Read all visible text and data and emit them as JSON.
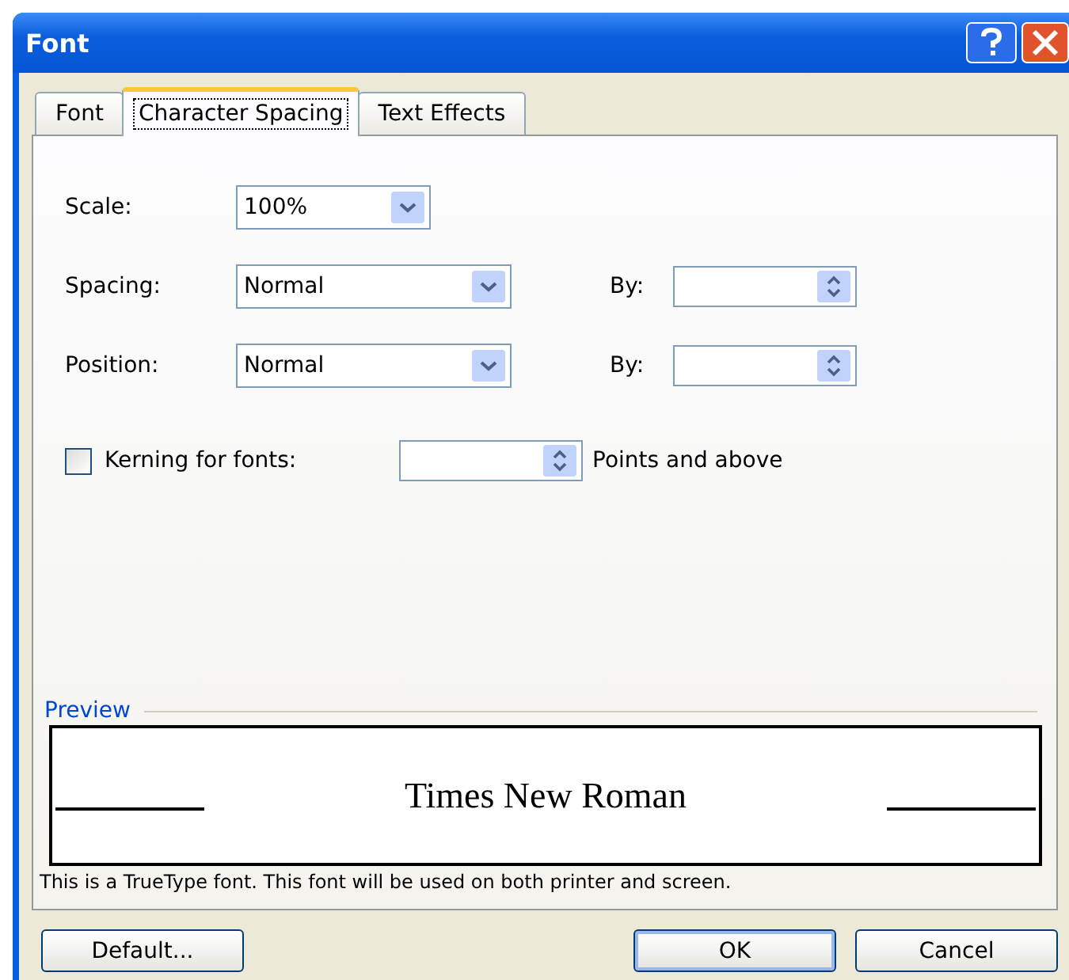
{
  "window": {
    "title": "Font"
  },
  "tabs": [
    {
      "label": "Font",
      "selected": false
    },
    {
      "label": "Character Spacing",
      "selected": true
    },
    {
      "label": "Text Effects",
      "selected": false
    }
  ],
  "rows": [
    {
      "kind": "combo",
      "label": "Scale:",
      "value": "100%"
    },
    {
      "kind": "combo-spin",
      "label": "Spacing:",
      "value": "Normal",
      "by_label": "By:"
    },
    {
      "kind": "combo-spin",
      "label": "Position:",
      "value": "Normal",
      "by_label": "By:"
    }
  ],
  "kerning": {
    "label": "Kerning for fonts:",
    "checked": false,
    "suffix": "Points and above"
  },
  "preview": {
    "title": "Preview",
    "sample": "Times New Roman",
    "note": "This is a TrueType font. This font will be used on both printer and screen."
  },
  "buttons": [
    {
      "label": "Default...",
      "kind": "left"
    },
    {
      "label": "OK",
      "kind": "default"
    },
    {
      "label": "Cancel",
      "kind": "normal"
    }
  ]
}
